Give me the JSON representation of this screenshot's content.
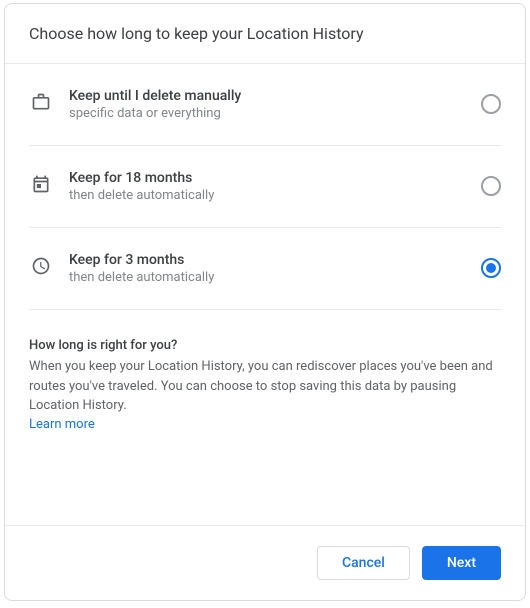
{
  "header": {
    "title": "Choose how long to keep your Location History"
  },
  "options": [
    {
      "title": "Keep until I delete manually",
      "subtitle": "specific data or everything",
      "selected": false
    },
    {
      "title": "Keep for 18 months",
      "subtitle": "then delete automatically",
      "selected": false
    },
    {
      "title": "Keep for 3 months",
      "subtitle": "then delete automatically",
      "selected": true
    }
  ],
  "info": {
    "title": "How long is right for you?",
    "text": "When you keep your Location History, you can rediscover places you've been and routes you've traveled. You can choose to stop saving this data by pausing Location History.",
    "learn_more": "Learn more"
  },
  "footer": {
    "cancel": "Cancel",
    "next": "Next"
  }
}
